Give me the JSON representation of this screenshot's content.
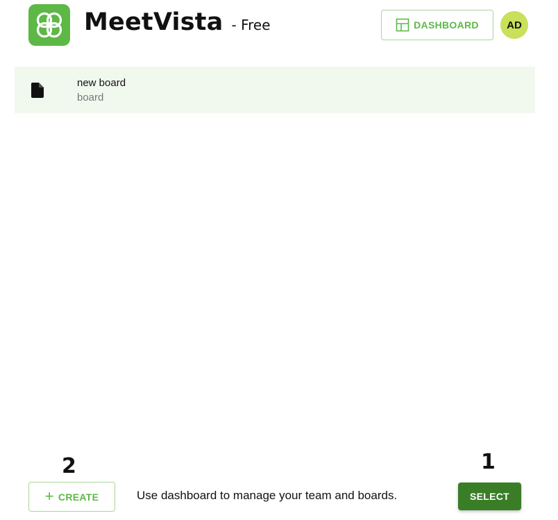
{
  "header": {
    "brand_name": "MeetVista",
    "plan": "- Free",
    "logo_icon": "clover-logo-icon",
    "dashboard_label": "DASHBOARD",
    "dashboard_icon": "layout-grid-icon",
    "avatar_initials": "AD"
  },
  "boards": [
    {
      "name": "new board",
      "type": "board",
      "icon": "file-icon"
    }
  ],
  "footer": {
    "create_label": "CREATE",
    "create_icon": "plus-icon",
    "hint": "Use dashboard to manage your team and boards.",
    "select_label": "SELECT",
    "marker_create": "2",
    "marker_select": "1"
  },
  "colors": {
    "brand_green": "#5db846",
    "primary_button": "#3a7d27",
    "row_highlight": "#f1f8ee",
    "avatar_bg": "#c8e05a",
    "outline_border": "#a9d49b"
  }
}
